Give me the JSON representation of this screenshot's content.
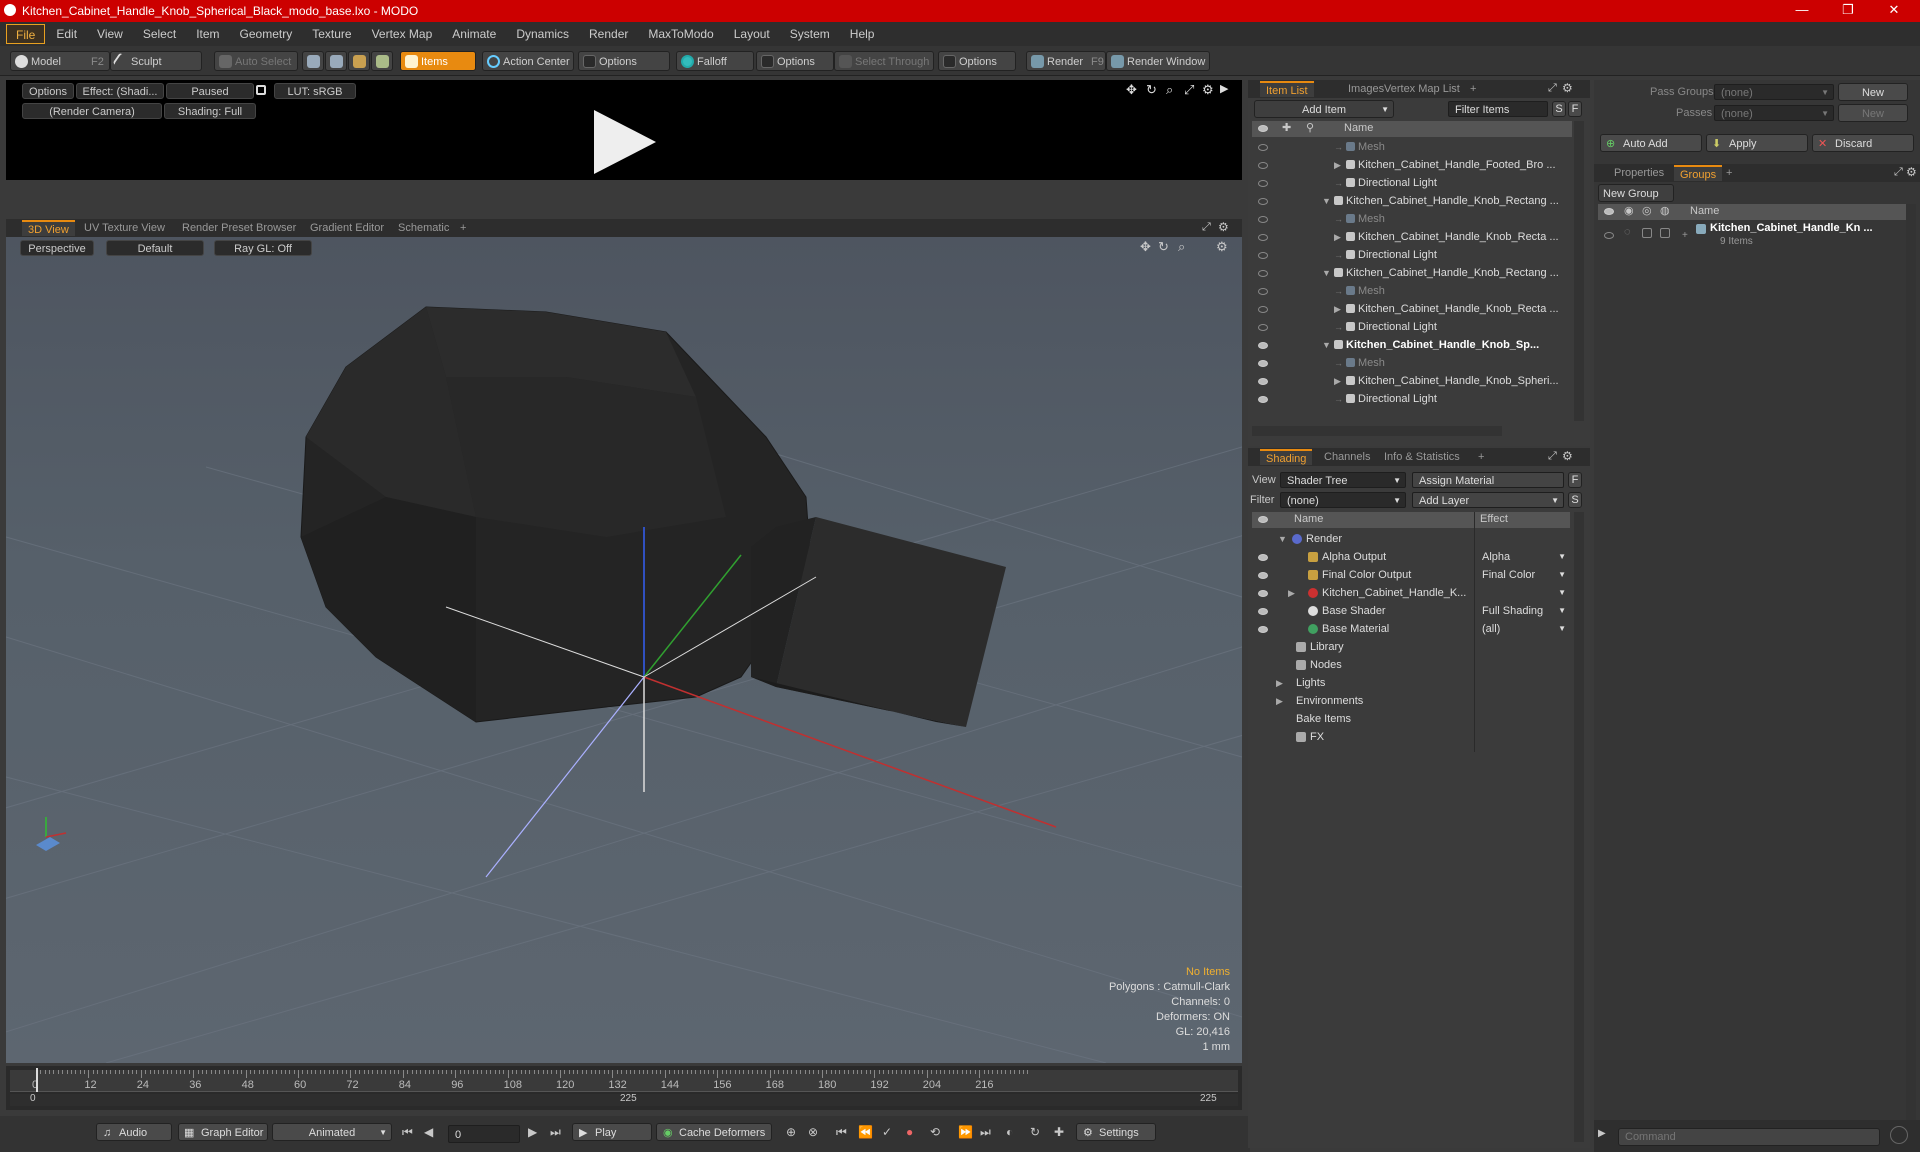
{
  "window": {
    "title": "Kitchen_Cabinet_Handle_Knob_Spherical_Black_modo_base.lxo - MODO"
  },
  "menu": [
    "File",
    "Edit",
    "View",
    "Select",
    "Item",
    "Geometry",
    "Texture",
    "Vertex Map",
    "Animate",
    "Dynamics",
    "Render",
    "MaxToModo",
    "Layout",
    "System",
    "Help"
  ],
  "toolbar": {
    "model": "Model",
    "model_key": "F2",
    "sculpt": "Sculpt",
    "auto_select": "Auto Select",
    "items": "Items",
    "action_center": "Action Center",
    "options1": "Options",
    "falloff": "Falloff",
    "options2": "Options",
    "select_through": "Select Through",
    "options3": "Options",
    "render": "Render",
    "render_key": "F9",
    "render_window": "Render Window"
  },
  "preview": {
    "options": "Options",
    "effect": "Effect: (Shadi...",
    "paused": "Paused",
    "lut": "LUT: sRGB",
    "camera": "(Render Camera)",
    "shading": "Shading: Full"
  },
  "viewport_tabs": [
    "3D View",
    "UV Texture View",
    "Render Preset Browser",
    "Gradient Editor",
    "Schematic"
  ],
  "viewport": {
    "projection": "Perspective",
    "style": "Default",
    "raygl": "Ray GL: Off"
  },
  "hud": {
    "line1": "No Items",
    "line2": "Polygons : Catmull-Clark",
    "line3": "Channels: 0",
    "line4": "Deformers: ON",
    "line5": "GL: 20,416",
    "line6": "1 mm"
  },
  "timeline": {
    "ticks": [
      "0",
      "12",
      "24",
      "36",
      "48",
      "60",
      "72",
      "84",
      "96",
      "108",
      "120",
      "132",
      "144",
      "156",
      "168",
      "180",
      "192",
      "204",
      "216"
    ],
    "start": "0",
    "mid": "225",
    "end": "225"
  },
  "bottombar": {
    "audio": "Audio",
    "graph_editor": "Graph Editor",
    "animated": "Animated",
    "frame": "0",
    "play": "Play",
    "cache": "Cache Deformers",
    "settings": "Settings"
  },
  "item_list": {
    "tabs": [
      "Item List",
      "Images",
      "Vertex Map List"
    ],
    "add_item": "Add Item",
    "filter": "Filter Items",
    "col_name": "Name",
    "rows": [
      {
        "label": "Mesh",
        "indent": 2,
        "grey": true,
        "eye": false,
        "arrow": ""
      },
      {
        "label": "Kitchen_Cabinet_Handle_Footed_Bro ...",
        "indent": 2,
        "grey": false,
        "eye": false,
        "arrow": "▶"
      },
      {
        "label": "Directional Light",
        "indent": 2,
        "grey": false,
        "eye": false,
        "arrow": ""
      },
      {
        "label": "Kitchen_Cabinet_Handle_Knob_Rectang ...",
        "indent": 1,
        "grey": false,
        "eye": false,
        "arrow": "▼"
      },
      {
        "label": "Mesh",
        "indent": 2,
        "grey": true,
        "eye": false,
        "arrow": ""
      },
      {
        "label": "Kitchen_Cabinet_Handle_Knob_Recta ...",
        "indent": 2,
        "grey": false,
        "eye": false,
        "arrow": "▶"
      },
      {
        "label": "Directional Light",
        "indent": 2,
        "grey": false,
        "eye": false,
        "arrow": ""
      },
      {
        "label": "Kitchen_Cabinet_Handle_Knob_Rectang ...",
        "indent": 1,
        "grey": false,
        "eye": false,
        "arrow": "▼"
      },
      {
        "label": "Mesh",
        "indent": 2,
        "grey": true,
        "eye": false,
        "arrow": ""
      },
      {
        "label": "Kitchen_Cabinet_Handle_Knob_Recta ...",
        "indent": 2,
        "grey": false,
        "eye": false,
        "arrow": "▶"
      },
      {
        "label": "Directional Light",
        "indent": 2,
        "grey": false,
        "eye": false,
        "arrow": ""
      },
      {
        "label": "Kitchen_Cabinet_Handle_Knob_Sp...",
        "indent": 1,
        "grey": false,
        "eye": true,
        "arrow": "▼",
        "bold": true
      },
      {
        "label": "Mesh",
        "indent": 2,
        "grey": true,
        "eye": true,
        "arrow": ""
      },
      {
        "label": "Kitchen_Cabinet_Handle_Knob_Spheri...",
        "indent": 2,
        "grey": false,
        "eye": true,
        "arrow": "▶"
      },
      {
        "label": "Directional Light",
        "indent": 2,
        "grey": false,
        "eye": true,
        "arrow": ""
      }
    ]
  },
  "shading": {
    "tabs": [
      "Shading",
      "Channels",
      "Info & Statistics"
    ],
    "view_label": "View",
    "view_value": "Shader Tree",
    "assign": "Assign Material",
    "filter_label": "Filter",
    "filter_value": "(none)",
    "add_layer": "Add Layer",
    "col_name": "Name",
    "col_effect": "Effect",
    "rows": [
      {
        "label": "Render",
        "effect": "",
        "indent": 0,
        "arrow": "▼",
        "eye": false,
        "icon": "sphere"
      },
      {
        "label": "Alpha Output",
        "effect": "Alpha",
        "indent": 1,
        "arrow": "",
        "eye": true,
        "icon": "output"
      },
      {
        "label": "Final Color Output",
        "effect": "Final Color",
        "indent": 1,
        "arrow": "",
        "eye": true,
        "icon": "output"
      },
      {
        "label": "Kitchen_Cabinet_Handle_K...",
        "effect": "",
        "indent": 1,
        "arrow": "▶",
        "eye": true,
        "icon": "material"
      },
      {
        "label": "Base Shader",
        "effect": "Full Shading",
        "indent": 1,
        "arrow": "",
        "eye": true,
        "icon": "shader"
      },
      {
        "label": "Base Material",
        "effect": "(all)",
        "indent": 1,
        "arrow": "",
        "eye": true,
        "icon": "basemat"
      },
      {
        "label": "Library",
        "effect": "",
        "indent": 0,
        "arrow": "",
        "eye": false,
        "icon": "folder"
      },
      {
        "label": "Nodes",
        "effect": "",
        "indent": 0,
        "arrow": "",
        "eye": false,
        "icon": "folder"
      },
      {
        "label": "Lights",
        "effect": "",
        "indent": -1,
        "arrow": "▶",
        "eye": false,
        "icon": ""
      },
      {
        "label": "Environments",
        "effect": "",
        "indent": -1,
        "arrow": "▶",
        "eye": false,
        "icon": ""
      },
      {
        "label": "Bake Items",
        "effect": "",
        "indent": -1,
        "arrow": "",
        "eye": false,
        "icon": ""
      },
      {
        "label": "FX",
        "effect": "",
        "indent": 0,
        "arrow": "",
        "eye": false,
        "icon": "fx"
      }
    ]
  },
  "groups_panel": {
    "pass_groups_label": "Pass Groups",
    "pass_groups_value": "(none)",
    "new": "New",
    "passes_label": "Passes",
    "passes_value": "(none)",
    "new2": "New",
    "auto_add": "Auto Add",
    "apply": "Apply",
    "discard": "Discard",
    "tabs": [
      "Properties",
      "Groups"
    ],
    "new_group": "New Group",
    "col_name": "Name",
    "group_name": "Kitchen_Cabinet_Handle_Kn ...",
    "group_count": "9 Items"
  },
  "command": {
    "placeholder": "Command"
  },
  "colors": {
    "accent": "#e88a10",
    "title": "#cc0000",
    "x_axis": "#c03030",
    "y_axis": "#30a030",
    "z_axis": "#3050c0"
  }
}
